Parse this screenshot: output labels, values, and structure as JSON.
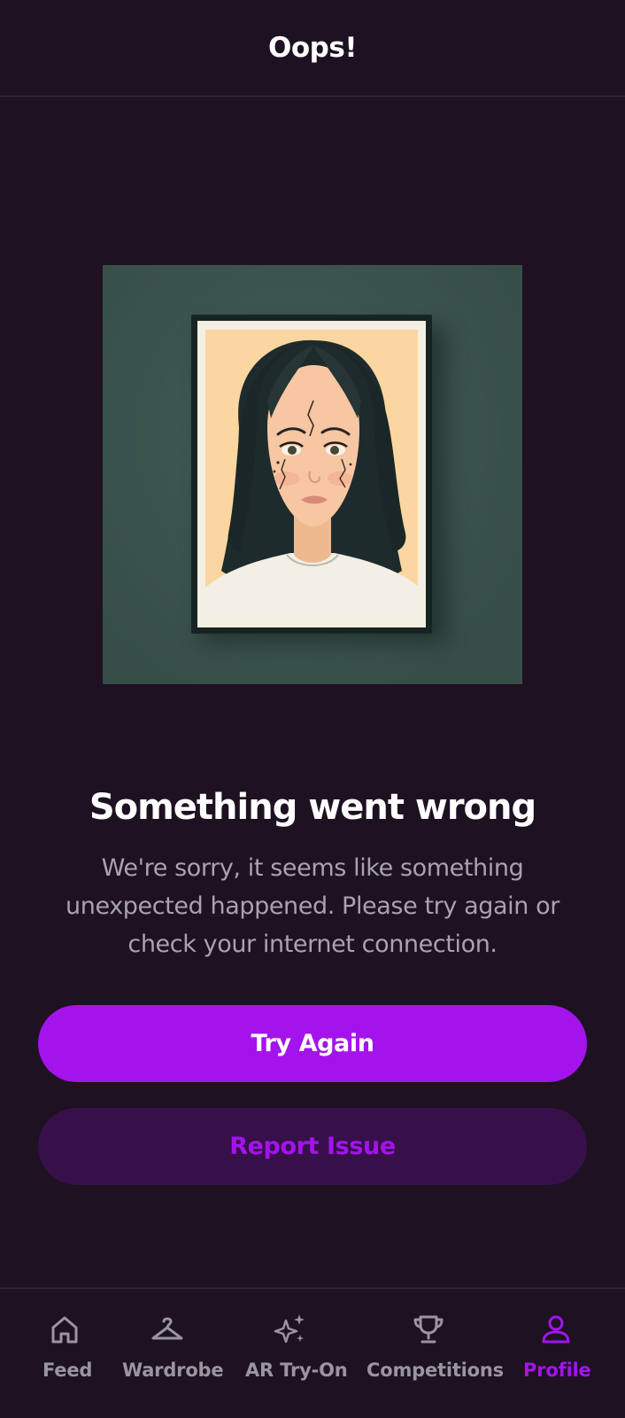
{
  "header": {
    "title": "Oops!"
  },
  "error": {
    "title": "Something went wrong",
    "message": "We're sorry, it seems like something unexpected happened. Please try again or check your internet connection."
  },
  "actions": {
    "primary_label": "Try Again",
    "secondary_label": "Report Issue"
  },
  "nav": {
    "items": [
      {
        "label": "Feed",
        "icon": "home-icon",
        "active": false
      },
      {
        "label": "Wardrobe",
        "icon": "hanger-icon",
        "active": false
      },
      {
        "label": "AR Try-On",
        "icon": "sparkles-icon",
        "active": false
      },
      {
        "label": "Competitions",
        "icon": "trophy-icon",
        "active": false
      },
      {
        "label": "Profile",
        "icon": "user-icon",
        "active": true
      }
    ]
  },
  "colors": {
    "background": "#1d1122",
    "accent": "#a413ec",
    "secondary_button_bg": "#37104a",
    "muted_text": "#a8a3ae",
    "illustration_bg": "#3c5650"
  }
}
